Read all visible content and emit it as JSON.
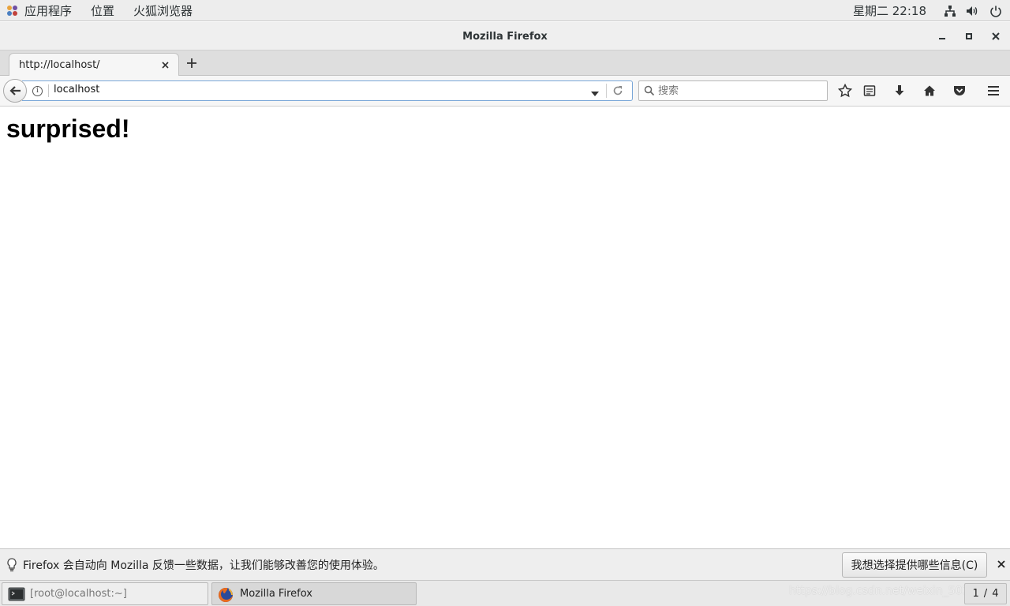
{
  "topbar": {
    "menus": [
      "应用程序",
      "位置",
      "火狐浏览器"
    ],
    "clock": "星期二 22:18",
    "tray_icons": [
      "network-icon",
      "volume-icon",
      "power-icon"
    ]
  },
  "window": {
    "title": "Mozilla Firefox"
  },
  "tabs": [
    {
      "label": "http://localhost/"
    }
  ],
  "navbar": {
    "url": "localhost",
    "search_placeholder": "搜索"
  },
  "page": {
    "heading": "surprised!"
  },
  "notification": {
    "message": "Firefox 会自动向 Mozilla 反馈一些数据，让我们能够改善您的使用体验。",
    "button_label": "我想选择提供哪些信息(C)"
  },
  "taskbar": {
    "tasks": [
      {
        "label": "[root@localhost:~]"
      },
      {
        "label": "Mozilla Firefox"
      }
    ],
    "watermark": "https://blog.csdn.net/weixin_5034428",
    "pager_current": "1",
    "pager_total": "4"
  },
  "colors": {
    "url_focus_border": "#7aa7d8",
    "chrome_bg": "#ededed"
  }
}
